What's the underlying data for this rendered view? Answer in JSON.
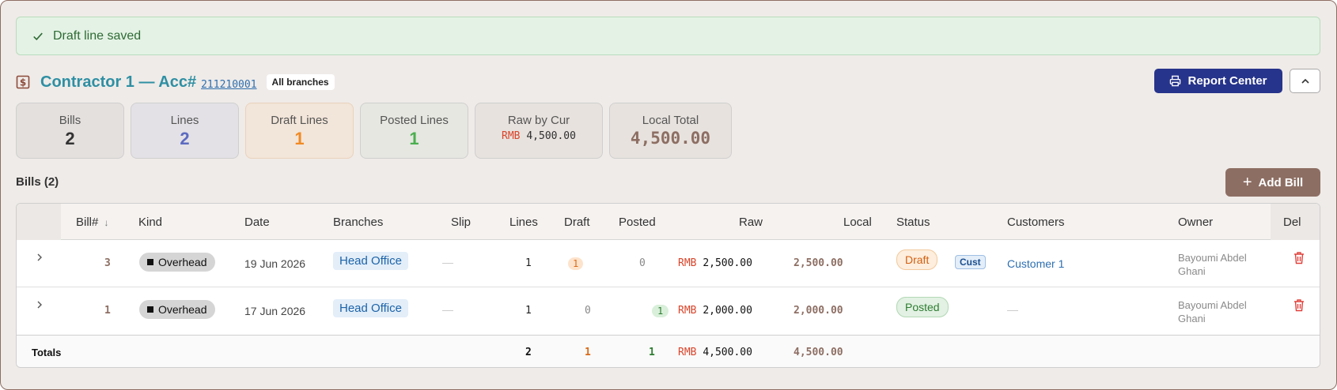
{
  "toast": {
    "message": "Draft line saved",
    "icon": "check-icon"
  },
  "header": {
    "title": "Contractor 1 — Acc#",
    "account_number": "211210001",
    "branches_chip": "All branches",
    "report_button": "Report Center",
    "icon": "dollar-document-icon"
  },
  "stats": [
    {
      "label": "Bills",
      "value": "2"
    },
    {
      "label": "Lines",
      "value": "2"
    },
    {
      "label": "Draft Lines",
      "value": "1"
    },
    {
      "label": "Posted Lines",
      "value": "1"
    },
    {
      "label": "Raw by Cur",
      "currency": "RMB",
      "value": "4,500.00"
    },
    {
      "label": "Local Total",
      "value": "4,500.00"
    }
  ],
  "bills_section": {
    "title": "Bills (2)",
    "add_button": "Add Bill"
  },
  "table": {
    "columns": [
      "Bill#",
      "Kind",
      "Date",
      "Branches",
      "Slip",
      "Lines",
      "Draft",
      "Posted",
      "Raw",
      "Local",
      "Status",
      "Customers",
      "Owner",
      "Del"
    ],
    "rows": [
      {
        "bill": "3",
        "kind": "Overhead",
        "date": "19 Jun 2026",
        "branch": "Head Office",
        "slip": "—",
        "lines": "1",
        "draft": "1",
        "posted": "0",
        "raw_currency": "RMB",
        "raw": "2,500.00",
        "local": "2,500.00",
        "status": "Draft",
        "status_tag": "Cust",
        "customer": "Customer 1",
        "owner": "Bayoumi Abdel Ghani"
      },
      {
        "bill": "1",
        "kind": "Overhead",
        "date": "17 Jun 2026",
        "branch": "Head Office",
        "slip": "—",
        "lines": "1",
        "draft": "0",
        "posted": "1",
        "raw_currency": "RMB",
        "raw": "2,000.00",
        "local": "2,000.00",
        "status": "Posted",
        "status_tag": "",
        "customer": "—",
        "owner": "Bayoumi Abdel Ghani"
      }
    ],
    "totals": {
      "label": "Totals",
      "lines": "2",
      "draft": "1",
      "posted": "1",
      "raw_currency": "RMB",
      "raw": "4,500.00",
      "local": "4,500.00"
    }
  },
  "colors": {
    "accent_title": "#2e8fa3",
    "report_button": "#27348b",
    "add_button": "#8d6e63",
    "draft": "#f08a24",
    "posted": "#4caf50",
    "lines": "#5c6bc0"
  }
}
